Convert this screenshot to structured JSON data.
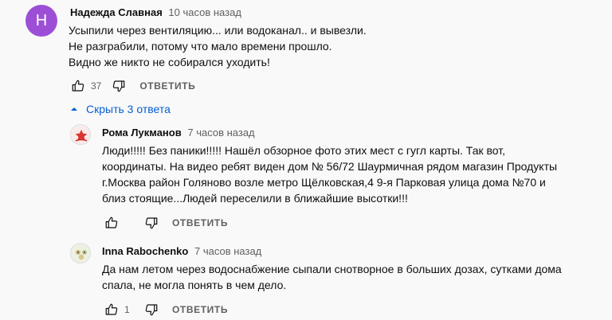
{
  "comments": [
    {
      "avatar_letter": "H",
      "author": "Надежда Славная",
      "time": "10 часов назад",
      "text": "Усыпили через вентиляцию... или водоканал.. и вывезли.\nНе разграбили, потому что мало времени прошло.\nВидно же никто не собирался уходить!",
      "likes": "37",
      "reply_label": "ОТВЕТИТЬ"
    }
  ],
  "replies_toggle": {
    "label": "Скрыть 3 ответа"
  },
  "replies": [
    {
      "author": "Рома Лукманов",
      "time": "7 часов назад",
      "text": "Люди!!!!! Без паники!!!!! Нашёл обзорное фото этих мест с гугл карты. Так вот,\nкоординаты. На видео ребят виден дом № 56/72 Шаурмичная рядом магазин Продукты\nг.Москва район Голяново  возле метро Щёлковская,4  9-я Парковая улица дома №70 и\nблиз стоящие...Людей переселили в ближайшие высотки!!!",
      "likes": "",
      "reply_label": "ОТВЕТИТЬ"
    },
    {
      "author": "Inna Rabochenko",
      "time": "7 часов назад",
      "text": "Да нам летом через водоснабжение сыпали снотворное в больших дозах, сутками дома\nспала, не могла понять в чем дело.",
      "likes": "1",
      "reply_label": "ОТВЕТИТЬ"
    }
  ],
  "icons": {
    "like": "thumbs-up-icon",
    "dislike": "thumbs-down-icon",
    "caret": "chevron-up-icon"
  },
  "colors": {
    "link_blue": "#065fd4",
    "avatar_purple": "#9c4fd6",
    "secondary_text": "#606060"
  }
}
